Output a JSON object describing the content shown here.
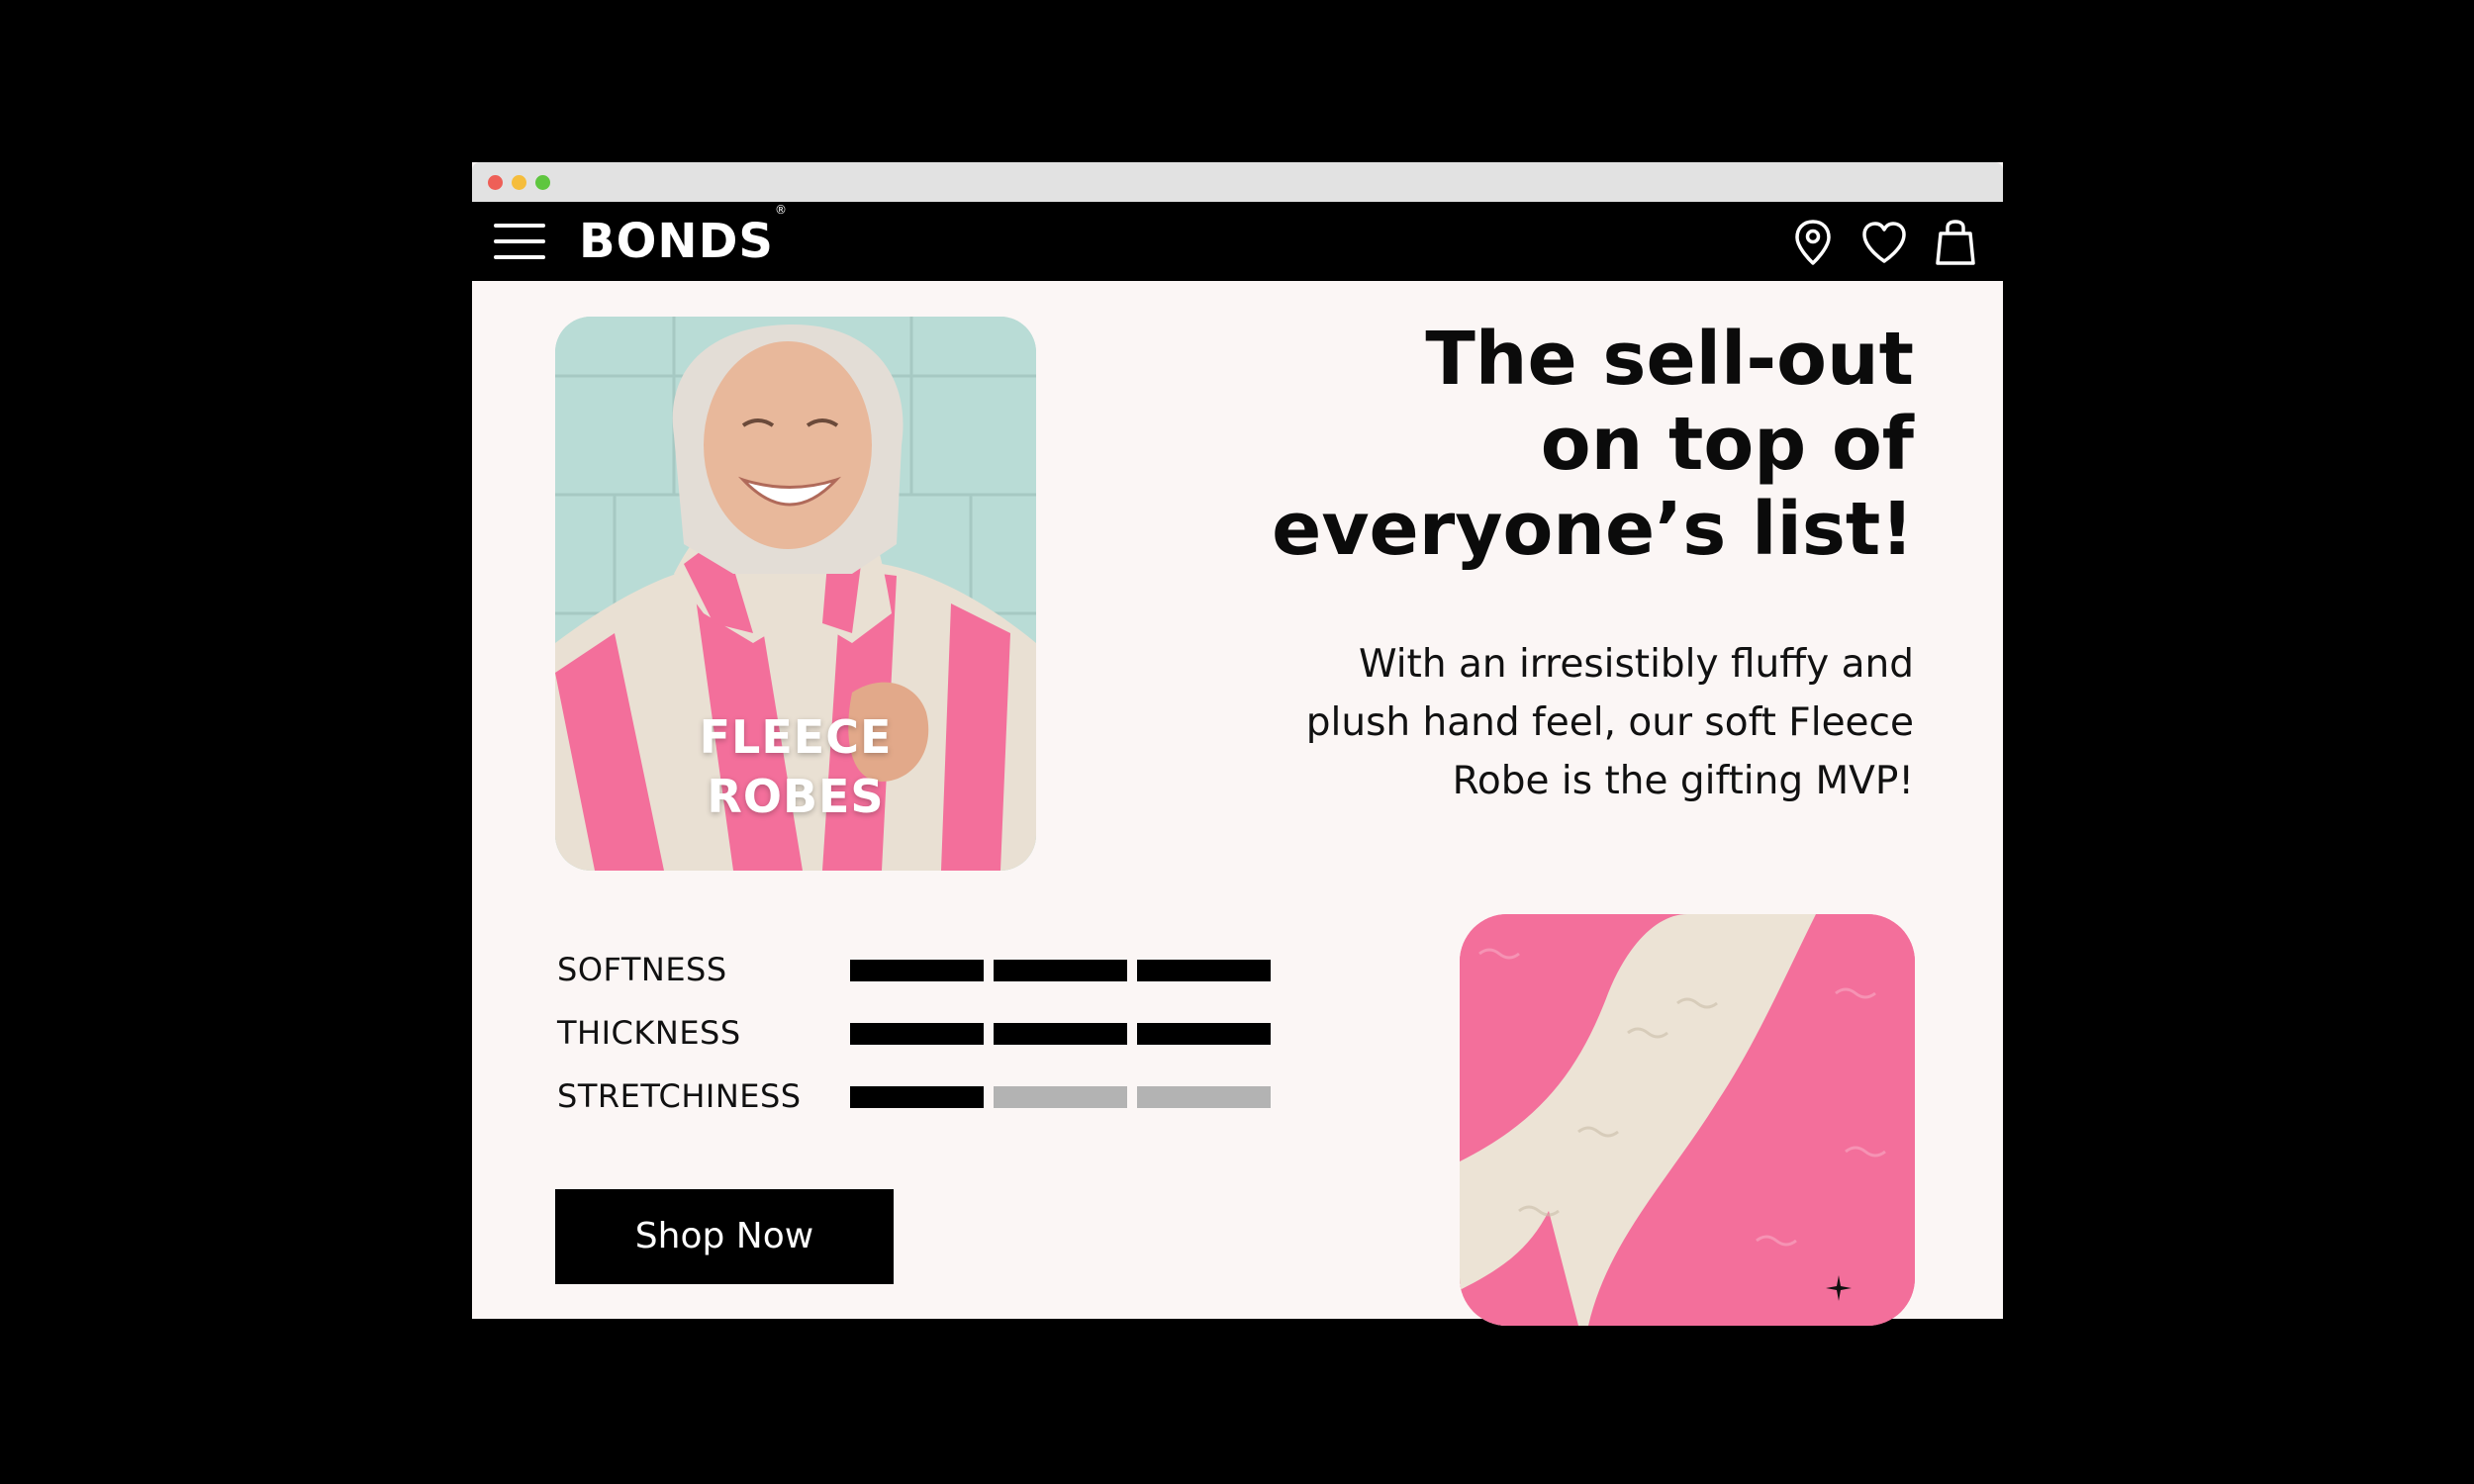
{
  "brand": {
    "logo_text": "BONDS",
    "registered_mark": "®"
  },
  "navbar": {
    "icons": [
      "menu-icon",
      "location-pin-icon",
      "heart-icon",
      "shopping-bag-icon"
    ]
  },
  "hero": {
    "image_caption_line1": "FLEECE",
    "image_caption_line2": "ROBES",
    "headline_line1": "The sell-out",
    "headline_line2": "on top of",
    "headline_line3": "everyone’s list!",
    "subcopy_line1": "With an irresistibly fluffy and",
    "subcopy_line2": "plush hand feel, our soft Fleece",
    "subcopy_line3": "Robe is the gifting MVP!"
  },
  "ratings": [
    {
      "label": "SOFTNESS",
      "level": 3,
      "max": 3
    },
    {
      "label": "THICKNESS",
      "level": 3,
      "max": 3
    },
    {
      "label": "STRETCHINESS",
      "level": 1,
      "max": 3
    }
  ],
  "cta": {
    "shop_now_label": "Shop Now"
  },
  "colors": {
    "background": "#000000",
    "page": "#fbf6f5",
    "navbar": "#000000",
    "pink": "#f36f9b",
    "cream": "#e9e0d3",
    "bar_on": "#000000",
    "bar_off": "#b3b3b3"
  }
}
